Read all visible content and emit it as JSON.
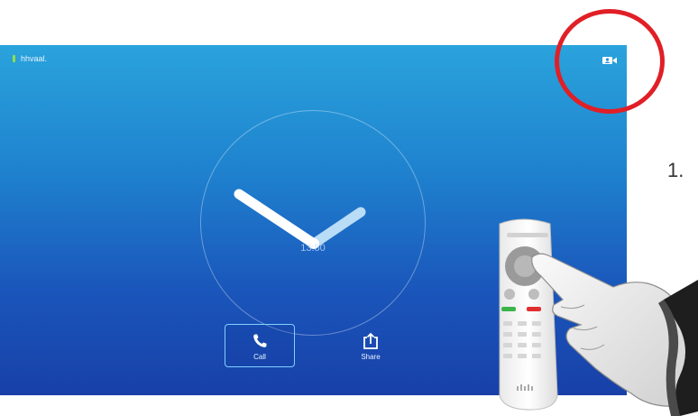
{
  "status": {
    "system_name": "hhvaal.",
    "indicator_color": "#8fe04a"
  },
  "header": {
    "selfview_icon": "camera-selfview-icon"
  },
  "clock": {
    "time": "13:50"
  },
  "actions": [
    {
      "label": "Call",
      "icon": "phone-icon",
      "selected": true
    },
    {
      "label": "Share",
      "icon": "share-icon",
      "selected": false
    }
  ],
  "annotation": {
    "step": "1.",
    "circle_color": "#e01f26"
  },
  "colors": {
    "screen_top": "#2aa3dc",
    "screen_bottom": "#1840a8",
    "focus_border": "#7fd0ff"
  }
}
